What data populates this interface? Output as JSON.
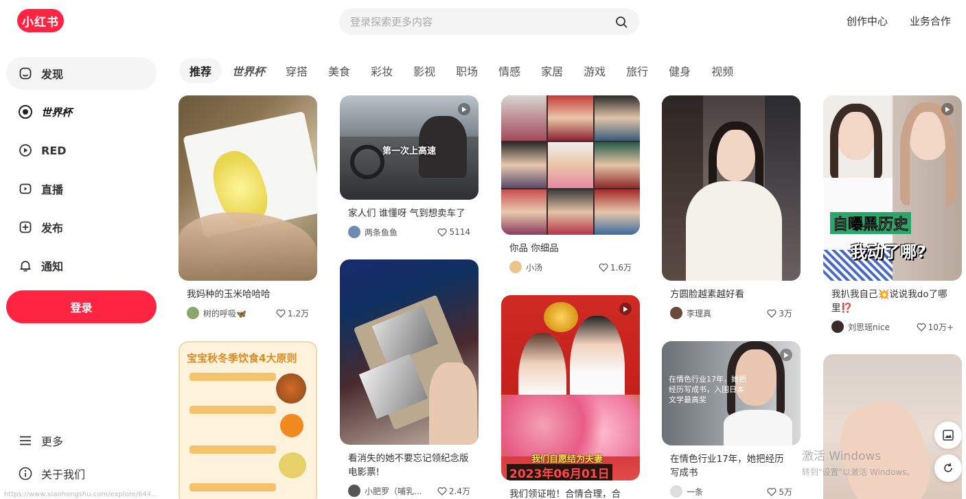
{
  "header": {
    "logo_text": "小红书",
    "search_placeholder": "登录探索更多内容",
    "links": [
      "创作中心",
      "业务合作"
    ]
  },
  "sidebar": {
    "items": [
      {
        "label": "发现",
        "icon": "home-icon",
        "active": true
      },
      {
        "label": "世界杯",
        "icon": "worldcup-icon"
      },
      {
        "label": "RED",
        "icon": "play-circle-icon"
      },
      {
        "label": "直播",
        "icon": "live-icon"
      },
      {
        "label": "发布",
        "icon": "plus-square-icon"
      },
      {
        "label": "通知",
        "icon": "bell-icon"
      }
    ],
    "login_label": "登录",
    "bottom": [
      {
        "label": "更多",
        "icon": "menu-icon"
      },
      {
        "label": "关于我们",
        "icon": "info-icon"
      }
    ]
  },
  "tabs": [
    "推荐",
    "世界杯",
    "穿搭",
    "美食",
    "彩妆",
    "影视",
    "职场",
    "情感",
    "家居",
    "游戏",
    "旅行",
    "健身",
    "视频"
  ],
  "feed": [
    {
      "title": "我妈种的玉米哈哈哈",
      "author": "树的呼吸🦋",
      "likes": "1.2万"
    },
    {
      "title": "",
      "author": "",
      "likes": "",
      "cover_title": "宝宝秋冬季饮食4大原则"
    },
    {
      "title": "家人们 谁懂呀 气到想卖车了",
      "author": "两条鱼鱼",
      "likes": "5114",
      "cover_caption": "第一次上高速"
    },
    {
      "title": "看消失的她不要忘记领纪念版电影票!",
      "author": "小肥罗（哺乳...",
      "likes": "2.4万"
    },
    {
      "title": "你品 你细品",
      "author": "小汤",
      "likes": "1.6万"
    },
    {
      "title": "我们领证啦！合情合理，合",
      "author": "",
      "likes": "",
      "cover_caption": "我们自愿结为夫妻",
      "cover_date": "2023年06月01日"
    },
    {
      "title": "方圆脸越素越好看",
      "author": "李理真",
      "likes": "3万"
    },
    {
      "title": "在情色行业17年，她把经历写成书",
      "author": "一条",
      "likes": "5万",
      "cover_caption": "在情色行业17年，她把经历写成书，入围日本文学最高奖"
    },
    {
      "title": "我扒我自己💥说说我do了哪里⁉️",
      "author": "刘思瑶nice",
      "likes": "10万+",
      "cover_caption_1": "自曝黑历史",
      "cover_caption_2": "我动了哪?"
    },
    {
      "title": "",
      "author": "",
      "likes": ""
    }
  ],
  "watermark": {
    "line1": "激活 Windows",
    "line2": "转到\"设置\"以激活 Windows。"
  },
  "status_url": "https://www.xiaohongshu.com/explore/644..."
}
